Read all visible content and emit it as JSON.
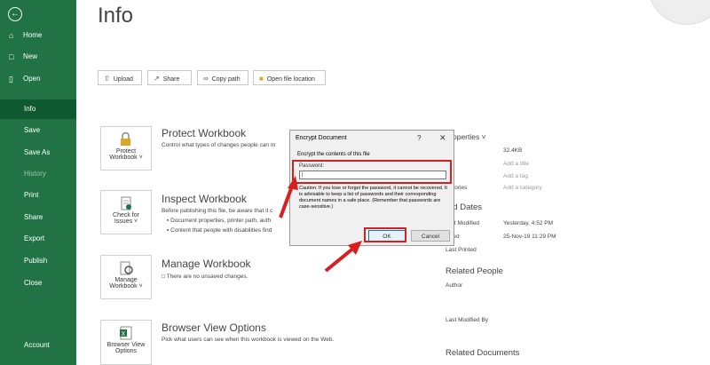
{
  "sidebar": {
    "back_icon": "back-arrow-icon",
    "items": [
      {
        "label": "Home",
        "icon": "home-icon"
      },
      {
        "label": "New",
        "icon": "new-doc-icon"
      },
      {
        "label": "Open",
        "icon": "folder-icon"
      },
      {
        "label": "Info"
      },
      {
        "label": "Save"
      },
      {
        "label": "Save As"
      },
      {
        "label": "History"
      },
      {
        "label": "Print"
      },
      {
        "label": "Share"
      },
      {
        "label": "Export"
      },
      {
        "label": "Publish"
      },
      {
        "label": "Close"
      },
      {
        "label": "Account"
      }
    ]
  },
  "page": {
    "title": "Info"
  },
  "toolbar": {
    "upload": "Upload",
    "share": "Share",
    "copy_path": "Copy path",
    "open_location": "Open file location"
  },
  "sections": {
    "protect": {
      "card_line1": "Protect",
      "card_line2": "Workbook ˅",
      "title": "Protect Workbook",
      "desc": "Control what types of changes people can m"
    },
    "inspect": {
      "card_line1": "Check for",
      "card_line2": "Issues ˅",
      "title": "Inspect Workbook",
      "desc": "Before publishing this file, be aware that it c",
      "bullet1": "Document properties, printer path, auth",
      "bullet2": "Content that people with disabilities find"
    },
    "manage": {
      "card_line1": "Manage",
      "card_line2": "Workbook ˅",
      "title": "Manage Workbook",
      "desc": "There are no unsaved changes."
    },
    "browser": {
      "card_line1": "Browser View",
      "card_line2": "Options",
      "title": "Browser View Options",
      "desc": "Pick what users can see when this workbook is viewed on the Web."
    }
  },
  "properties": {
    "header": "operties ˅",
    "size_label": "e",
    "size": "32.4KB",
    "title_label": "e",
    "title_placeholder": "Add a title",
    "tags_label": "s",
    "tags_placeholder": "Add a tag",
    "cat_label": "egories",
    "cat_placeholder": "Add a category",
    "dates_header": "ed Dates",
    "last_modified_label": "ast Modified",
    "last_modified": "Yesterday, 4:52 PM",
    "created_label": "ated",
    "created": "25-Nov-19 11:29 PM",
    "last_printed_label": "Last Printed",
    "people_header": "Related People",
    "author_label": "Author",
    "modified_by_label": "Last Modified By",
    "docs_header": "Related Documents"
  },
  "dialog": {
    "title": "Encrypt Document",
    "help": "?",
    "close": "✕",
    "subtitle": "Encrypt the contents of this file",
    "password_label": "Password:",
    "password_value": "|",
    "caution": "Caution: If you lose or forget the password, it cannot be recovered. It is advisable to keep a list of passwords and their corresponding document names in a safe place. (Remember that passwords are case-sensitive.)",
    "ok": "OK",
    "cancel": "Cancel"
  },
  "colors": {
    "sidebar": "#217346",
    "annotation": "#d81e1e"
  }
}
